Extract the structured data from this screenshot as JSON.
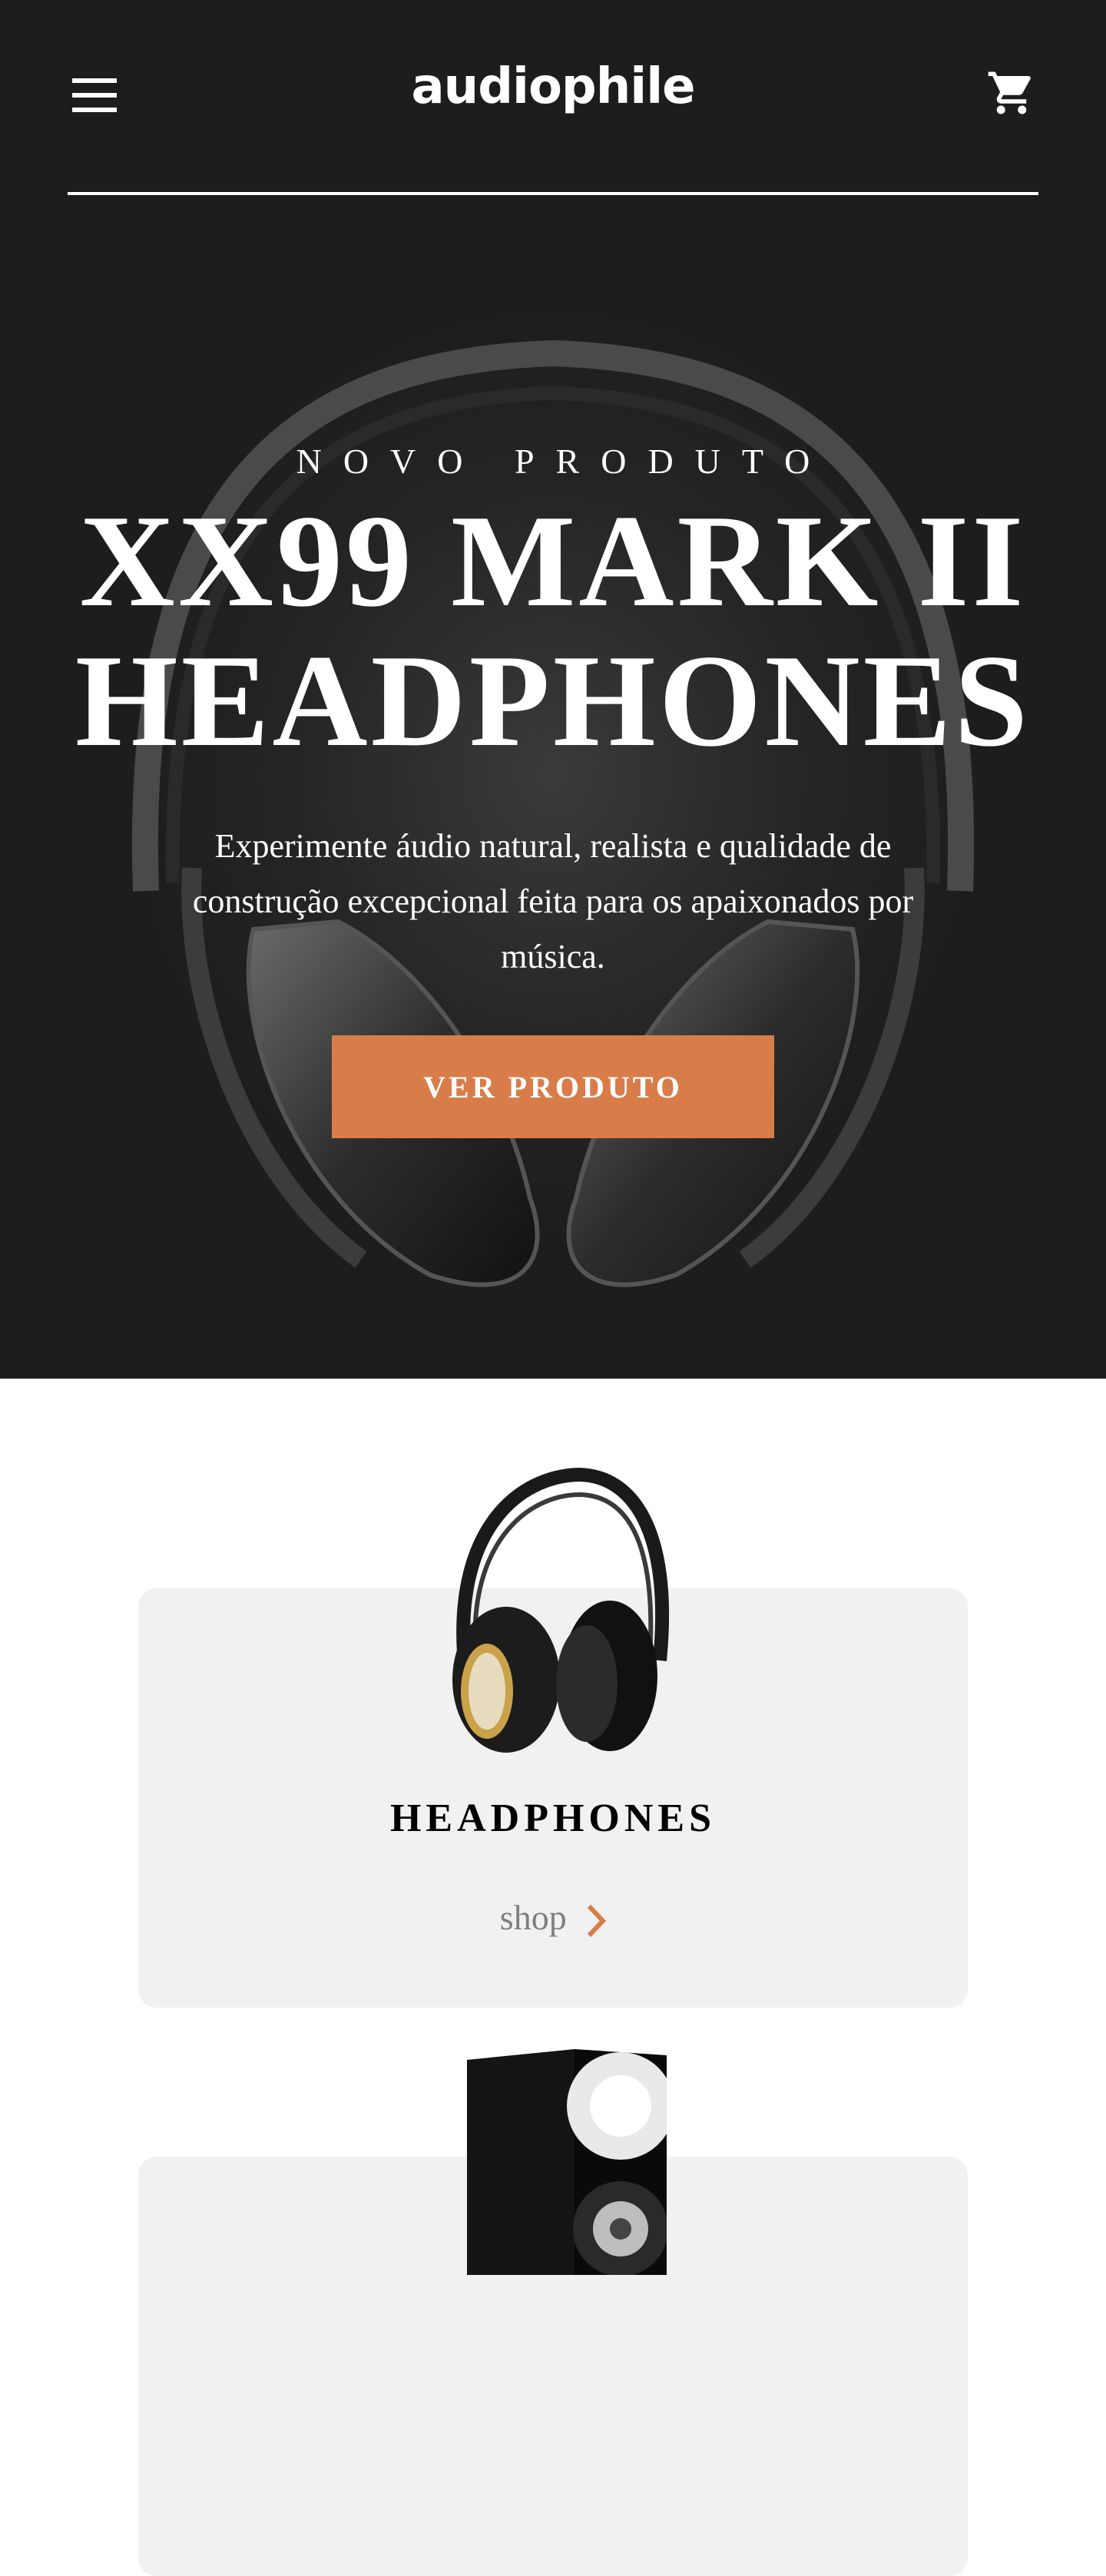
{
  "header": {
    "logo": "audiophile",
    "menu_icon": "hamburger-menu-icon",
    "cart_icon": "shopping-cart-icon"
  },
  "hero": {
    "overline": "NOVO PRODUTO",
    "title_line1": "XX99 MARK II",
    "title_line2": "HEADPHONES",
    "description": "Experimente áudio natural, realista e qualidade de construção excepcional feita para os apaixonados por música.",
    "cta_label": "VER PRODUTO"
  },
  "categories": [
    {
      "title": "HEADPHONES",
      "link_label": "shop",
      "icon": "chevron-right-icon"
    },
    {
      "title": "",
      "link_label": "",
      "icon": "speaker-image"
    }
  ],
  "colors": {
    "accent": "#d87d4a",
    "hero_bg": "#1d1d1d",
    "card_bg": "#f1f1f1",
    "text_light": "#ffffff",
    "muted": "#7f7f7f"
  }
}
